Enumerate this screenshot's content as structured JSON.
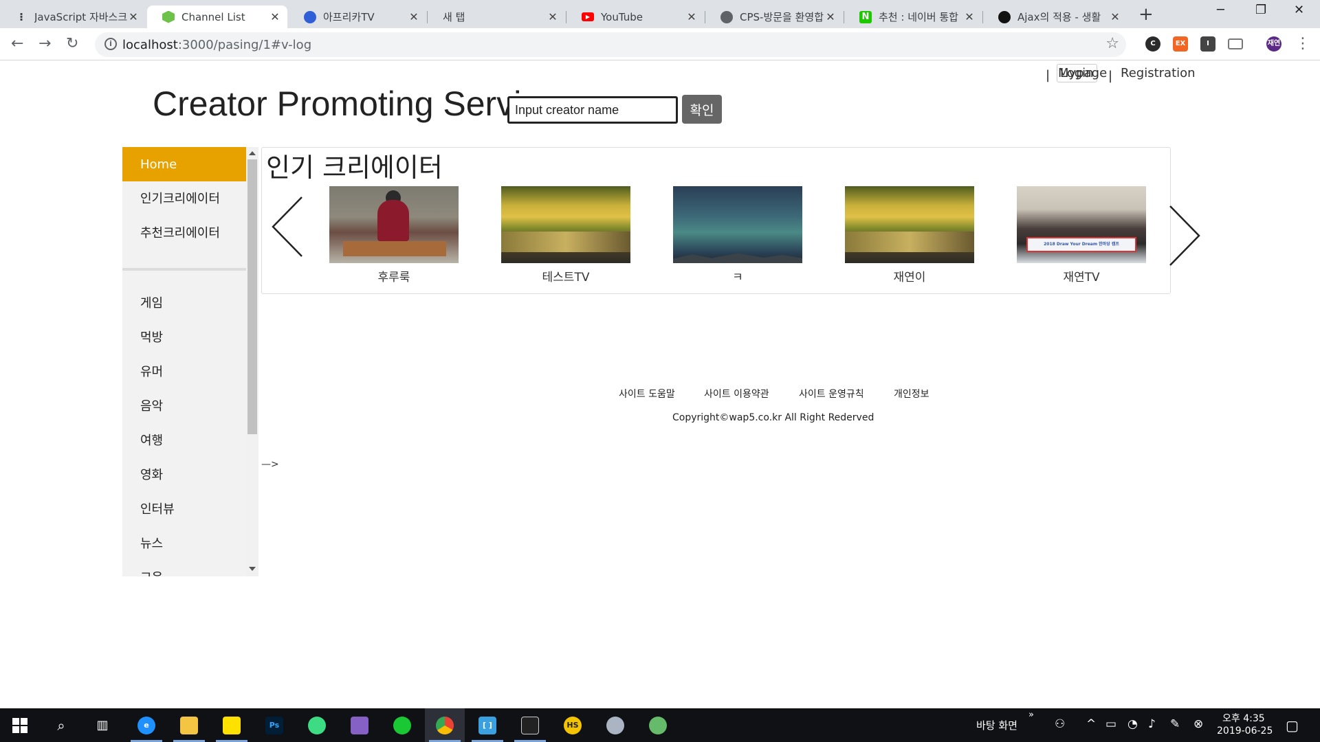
{
  "browser": {
    "tabs": [
      {
        "title": "JavaScript 자바스크",
        "icon": "dots-icon",
        "color": "#3c4043",
        "active": false
      },
      {
        "title": "Channel List",
        "icon": "nodejs-icon",
        "color": "#6cc24a",
        "active": true
      },
      {
        "title": "아프리카TV",
        "icon": "afreecatv-icon",
        "color": "#2f5ed6",
        "active": false
      },
      {
        "title": "새 탭",
        "icon": "none",
        "color": "",
        "active": false
      },
      {
        "title": "YouTube",
        "icon": "youtube-icon",
        "color": "#ff0000",
        "active": false
      },
      {
        "title": "CPS-방문을 환영합",
        "icon": "globe-icon",
        "color": "#5f6368",
        "active": false
      },
      {
        "title": "추천 : 네이버 통합",
        "icon": "naver-icon",
        "color": "#1ec800",
        "active": false
      },
      {
        "title": "Ajax의 적용 - 생활",
        "icon": "circle-icon",
        "color": "#111111",
        "active": false
      }
    ],
    "newtab_symbol": "+",
    "url_host": "localhost",
    "url_rest": ":3000/pasing/1#v-log",
    "profile_initials": "재연",
    "ext_labels": [
      "C",
      "EX",
      "I"
    ]
  },
  "page": {
    "site_title": "Creator Promoting Servi",
    "top_nav": {
      "login": "Login",
      "separator": "|",
      "mypage": "Mypage",
      "registration": "Registration"
    },
    "search": {
      "placeholder": "Input creator name",
      "button": "확인"
    },
    "sidebar": {
      "home": "Home",
      "primary": [
        "인기크리에이터",
        "추천크리에이터"
      ],
      "categories": [
        "게임",
        "먹방",
        "유머",
        "음악",
        "여행",
        "영화",
        "인터뷰",
        "뉴스",
        "교육"
      ]
    },
    "popular": {
      "title": "인기 크리에이터",
      "creators": [
        {
          "name": "후루룩",
          "thumb": "person-photo"
        },
        {
          "name": "테스트TV",
          "thumb": "forest-river-photo"
        },
        {
          "name": "ㅋ",
          "thumb": "night-sky-photo"
        },
        {
          "name": "재연이",
          "thumb": "forest-river-photo"
        },
        {
          "name": "재연TV",
          "thumb": "group-photo"
        }
      ],
      "banner_text": "2018 Draw Your Dream 한마당 캠프"
    },
    "footer": {
      "links": [
        "사이트 도움말",
        "사이트 이용약관",
        "사이트 운영규칙",
        "개인정보"
      ],
      "copyright": "Copyright©wap5.co.kr All Right Rederved"
    },
    "stray_text": "—>"
  },
  "taskbar": {
    "desktop_label": "바탕 화면",
    "chevron": "»",
    "time": "오후 4:35",
    "date": "2019-06-25",
    "apps": [
      {
        "name": "start-icon",
        "color": "#ffffff"
      },
      {
        "name": "search-icon",
        "color": "#ffffff"
      },
      {
        "name": "task-view-icon",
        "color": "#ffffff"
      },
      {
        "name": "edge-icon",
        "color": "#1e90ff"
      },
      {
        "name": "file-explorer-icon",
        "color": "#f4c542"
      },
      {
        "name": "sticky-notes-icon",
        "color": "#ffe100"
      },
      {
        "name": "photoshop-icon",
        "color": "#31a8ff"
      },
      {
        "name": "android-studio-icon",
        "color": "#3ddc84"
      },
      {
        "name": "visual-studio-icon",
        "color": "#8661c5"
      },
      {
        "name": "green-app-icon",
        "color": "#19c832"
      },
      {
        "name": "chrome-icon",
        "color": "#4285f4"
      },
      {
        "name": "bracket-app-icon",
        "color": "#3aa0e0"
      },
      {
        "name": "terminal-icon",
        "color": "#cccccc"
      },
      {
        "name": "hs-app-icon",
        "color": "#f5c400"
      },
      {
        "name": "settings-app-icon",
        "color": "#aab4c3"
      },
      {
        "name": "atom-icon",
        "color": "#66bb6a"
      }
    ]
  }
}
